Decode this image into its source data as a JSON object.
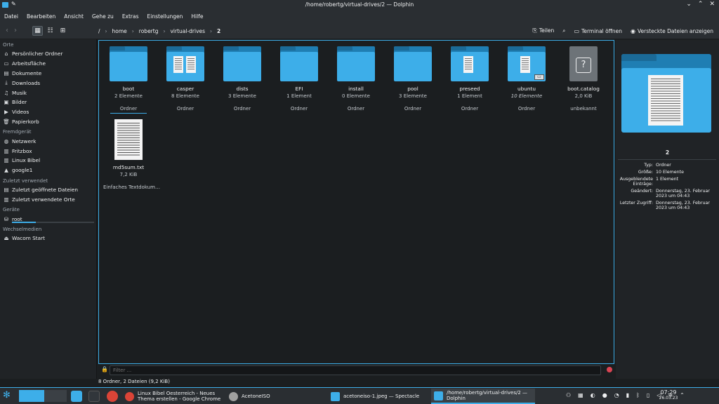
{
  "window": {
    "title": "/home/robertg/virtual-drives/2 — Dolphin"
  },
  "menu": [
    "Datei",
    "Bearbeiten",
    "Ansicht",
    "Gehe zu",
    "Extras",
    "Einstellungen",
    "Hilfe"
  ],
  "breadcrumb": {
    "root": "/",
    "parts": [
      "home",
      "robertg",
      "virtual-drives"
    ],
    "current": "2"
  },
  "toolbar": {
    "split": "Teilen",
    "terminal": "Terminal öffnen",
    "hidden": "Versteckte Dateien anzeigen"
  },
  "sidebar": {
    "places_header": "Orte",
    "places": [
      {
        "label": "Persönlicher Ordner",
        "icon": "home-icon"
      },
      {
        "label": "Arbeitsfläche",
        "icon": "desktop-icon"
      },
      {
        "label": "Dokumente",
        "icon": "documents-icon"
      },
      {
        "label": "Downloads",
        "icon": "downloads-icon"
      },
      {
        "label": "Musik",
        "icon": "music-icon"
      },
      {
        "label": "Bilder",
        "icon": "pictures-icon"
      },
      {
        "label": "Videos",
        "icon": "videos-icon"
      },
      {
        "label": "Papierkorb",
        "icon": "trash-icon"
      }
    ],
    "remote_header": "Fremdgerät",
    "remote": [
      {
        "label": "Netzwerk",
        "icon": "network-icon"
      },
      {
        "label": "Fritzbox",
        "icon": "network-folder-icon"
      },
      {
        "label": "Linux Bibel",
        "icon": "network-folder-icon"
      },
      {
        "label": "google1",
        "icon": "google-drive-icon"
      }
    ],
    "recent_header": "Zuletzt verwendet",
    "recent": [
      {
        "label": "Zuletzt geöffnete Dateien",
        "icon": "recent-files-icon"
      },
      {
        "label": "Zuletzt verwendete Orte",
        "icon": "recent-places-icon"
      }
    ],
    "devices_header": "Geräte",
    "devices": [
      {
        "label": "root",
        "icon": "drive-icon",
        "usage": 0.29
      }
    ],
    "removable_header": "Wechselmedien",
    "removable": [
      {
        "label": "Wacom Start",
        "icon": "removable-drive-icon"
      }
    ]
  },
  "files": [
    {
      "name": "boot",
      "sub": "2 Elemente",
      "type": "Ordner",
      "kind": "folder",
      "selected": true
    },
    {
      "name": "casper",
      "sub": "8 Elemente",
      "type": "Ordner",
      "kind": "folder-docs"
    },
    {
      "name": "dists",
      "sub": "3 Elemente",
      "type": "Ordner",
      "kind": "folder"
    },
    {
      "name": "EFI",
      "sub": "1 Element",
      "type": "Ordner",
      "kind": "folder"
    },
    {
      "name": "install",
      "sub": "0 Elemente",
      "type": "Ordner",
      "kind": "folder"
    },
    {
      "name": "pool",
      "sub": "3 Elemente",
      "type": "Ordner",
      "kind": "folder"
    },
    {
      "name": "preseed",
      "sub": "1 Element",
      "type": "Ordner",
      "kind": "folder-doc"
    },
    {
      "name": "ubuntu",
      "sub": "10 Elemente",
      "type": "Ordner",
      "kind": "folder-doc-link"
    },
    {
      "name": "boot.catalog",
      "sub": "2,0 KiB",
      "type": "unbekannt",
      "kind": "unknown"
    },
    {
      "name": "md5sum.txt",
      "sub": "7,2 KiB",
      "type": "Einfaches Textdokum…",
      "kind": "text"
    }
  ],
  "filter": {
    "placeholder": "Filter ..."
  },
  "status": {
    "text": "8 Ordner, 2 Dateien (9,2 KiB)"
  },
  "info": {
    "name": "2",
    "rows": [
      {
        "k": "Typ:",
        "v": "Ordner"
      },
      {
        "k": "Größe:",
        "v": "10 Elemente"
      },
      {
        "k": "Ausgeblendete Einträge:",
        "v": "1 Element"
      },
      {
        "k": "Geändert:",
        "v": "Donnerstag, 23. Februar 2023 um 04:43"
      },
      {
        "k": "Letzter Zugriff:",
        "v": "Donnerstag, 23. Februar 2023 um 04:43"
      }
    ]
  },
  "taskbar": {
    "tasks": [
      {
        "label": "Linux Bibel Oesterreich - Neues Thema erstellen - Google Chrome",
        "icon": "chrome-icon"
      },
      {
        "label": "AcetoneISO",
        "icon": "acetoneiso-icon"
      },
      {
        "label": "acetoneiso-1.jpeg — Spectacle",
        "icon": "spectacle-icon"
      },
      {
        "label": "/home/robertg/virtual-drives/2 — Dolphin",
        "icon": "dolphin-icon"
      }
    ],
    "time": "07:29",
    "date": "26.03.23"
  },
  "colors": {
    "accent": "#3daee9",
    "background": "#1b1e20",
    "panel": "#2a2e32"
  }
}
